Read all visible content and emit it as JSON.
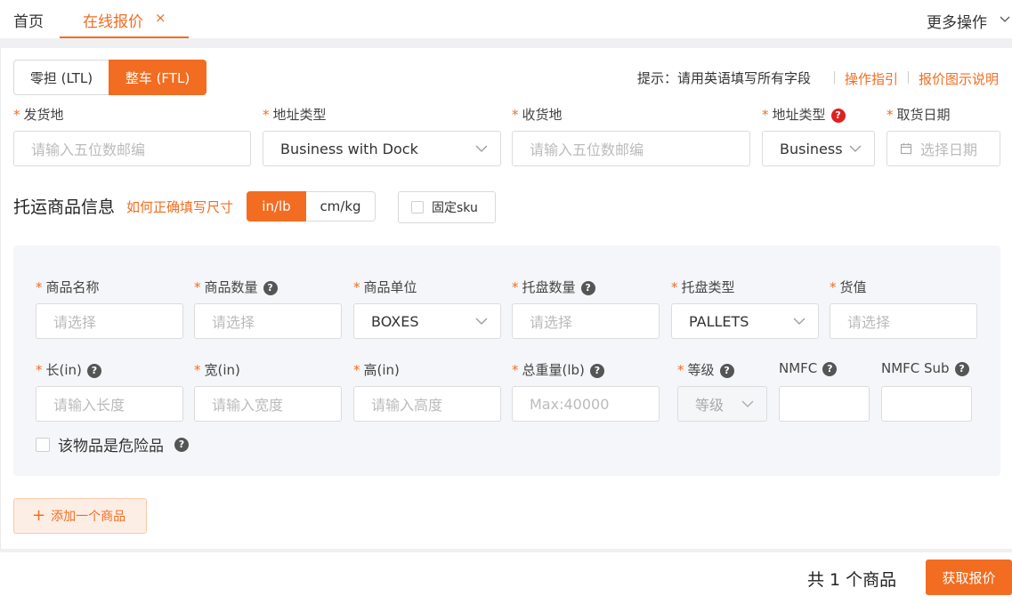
{
  "tabs": {
    "home": "首页",
    "active": "在线报价",
    "close": "×",
    "more": "更多操作"
  },
  "mode": {
    "ltl": "零担 (LTL)",
    "ftl": "整车 (FTL)"
  },
  "hint": {
    "text": "提示：请用英语填写所有字段",
    "guide": "操作指引",
    "explain": "报价图示说明"
  },
  "route": {
    "origin_label": "发货地",
    "origin_placeholder": "请输入五位数邮编",
    "origin_type_label": "地址类型",
    "origin_type_value": "Business with Dock",
    "dest_label": "收货地",
    "dest_placeholder": "请输入五位数邮编",
    "dest_type_label": "地址类型",
    "dest_type_value": "Business",
    "pickup_label": "取货日期",
    "pickup_placeholder": "选择日期"
  },
  "goods": {
    "title": "托运商品信息",
    "size_link": "如何正确填写尺寸",
    "unit_in": "in/lb",
    "unit_cm": "cm/kg",
    "fixed_sku": "固定sku"
  },
  "item": {
    "name_label": "商品名称",
    "name_placeholder": "请选择",
    "qty_label": "商品数量",
    "qty_placeholder": "请选择",
    "unit_label": "商品单位",
    "unit_value": "BOXES",
    "pallet_qty_label": "托盘数量",
    "pallet_qty_placeholder": "请选择",
    "pallet_type_label": "托盘类型",
    "pallet_type_value": "PALLETS",
    "value_label": "货值",
    "value_placeholder": "请选择",
    "length_label": "长(in)",
    "length_placeholder": "请输入长度",
    "width_label": "宽(in)",
    "width_placeholder": "请输入宽度",
    "height_label": "高(in)",
    "height_placeholder": "请输入高度",
    "weight_label": "总重量(lb)",
    "weight_placeholder": "Max:40000",
    "grade_label": "等级",
    "grade_placeholder": "等级",
    "nmfc_label": "NMFC",
    "nmfc_sub_label": "NMFC Sub",
    "dangerous_label": "该物品是危险品"
  },
  "add_item": "添加一个商品",
  "footer": {
    "total": "共 1 个商品",
    "get_quote": "获取报价"
  },
  "colors": {
    "accent": "#f26d21",
    "panel": "#f5f6f9"
  }
}
